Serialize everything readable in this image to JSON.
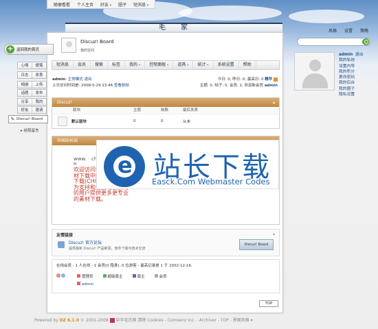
{
  "topbar": {
    "items": [
      "随便看看",
      "个人主页",
      "好友",
      "圈子",
      "短消息"
    ]
  },
  "toplinks": [
    "风格",
    "设置",
    "策略"
  ],
  "header": {
    "char1": "毛",
    "char2": "家",
    "board_title": "Discuz! Board",
    "board_subtitle": "我的空间"
  },
  "nav": [
    "短消息",
    "会员",
    "搜索",
    "标签",
    "我的",
    "控制面板",
    "道具",
    "统计",
    "系统设置",
    "帮助"
  ],
  "info": {
    "user": "admin",
    "sep": ":",
    "mode_label": "正常模式",
    "logout": "退出",
    "last_visit": "上次访问时间是: 2008-5-29 13:46",
    "new_posts": "查看新帖",
    "stats_line1": "今日: 0, 昨日: 0, 最高日: 0",
    "digest": "精华",
    "stats_line2": "主题: 0, 帖子: 0, 会员: 1, 欢迎新会员",
    "new_member": "admin"
  },
  "section1": {
    "title": "Discuz!",
    "cols": [
      "版块",
      "主题",
      "帖数",
      "最后发表"
    ],
    "row": {
      "name": "默认版块",
      "topics": "0",
      "posts": "0",
      "last": "从未"
    }
  },
  "section2": {
    "title": "中国站长站",
    "small1": "www.",
    "small2": "ch",
    "small3": "M",
    "text": "欢迎访问中国站长站素材下载中国站长站素材下载(CHINAZ.COM),为支持和爱爱站长素材的用户提供更多更专业的素材下载。"
  },
  "friend": {
    "title": "友情链接",
    "name": "Discuz! 官方论坛",
    "desc": "提供最新 Discuz! 产品新闻、软件下载与技术交流",
    "badge": "Discuz! Board"
  },
  "online": {
    "title": "在线会员 - 1 人在线 - 1 会员(0 隐身), 0 位游客 - 最高记录是 1 于 2002-12-16.",
    "legend": [
      "管理员",
      "超级版主",
      "版主",
      "会员"
    ],
    "user": "admin",
    "top": "TOP"
  },
  "footer": {
    "pre": "Powered by",
    "brand": "DZ",
    "ver": "6.1.0",
    "copy": "© 2001-2008",
    "rest": "中华毛氏网  清除 Cookies - Comsenz Inc. - Archiver - TOP - 界面风格 ▾"
  },
  "left": {
    "back_home": "返回我的首页",
    "rows": [
      [
        "心情",
        "便笺"
      ],
      [
        "日志",
        "发表"
      ],
      [
        "相册",
        "上传"
      ],
      [
        "话题",
        "发布"
      ],
      [
        "分享",
        "我的"
      ],
      [
        "好友",
        "邀请"
      ]
    ],
    "dz_board": "Discuz! Board",
    "favs": "▸ 结我留言"
  },
  "right": {
    "user": "admin",
    "logout": "退出",
    "menu": [
      "我的私信",
      "设置内导",
      "我的积分",
      "更改密码",
      "我的后台",
      "我的圈子",
      "隐私设置"
    ]
  },
  "watermark": {
    "big": "站长下载",
    "sub": "Easck.Com Webmaster Codes"
  }
}
